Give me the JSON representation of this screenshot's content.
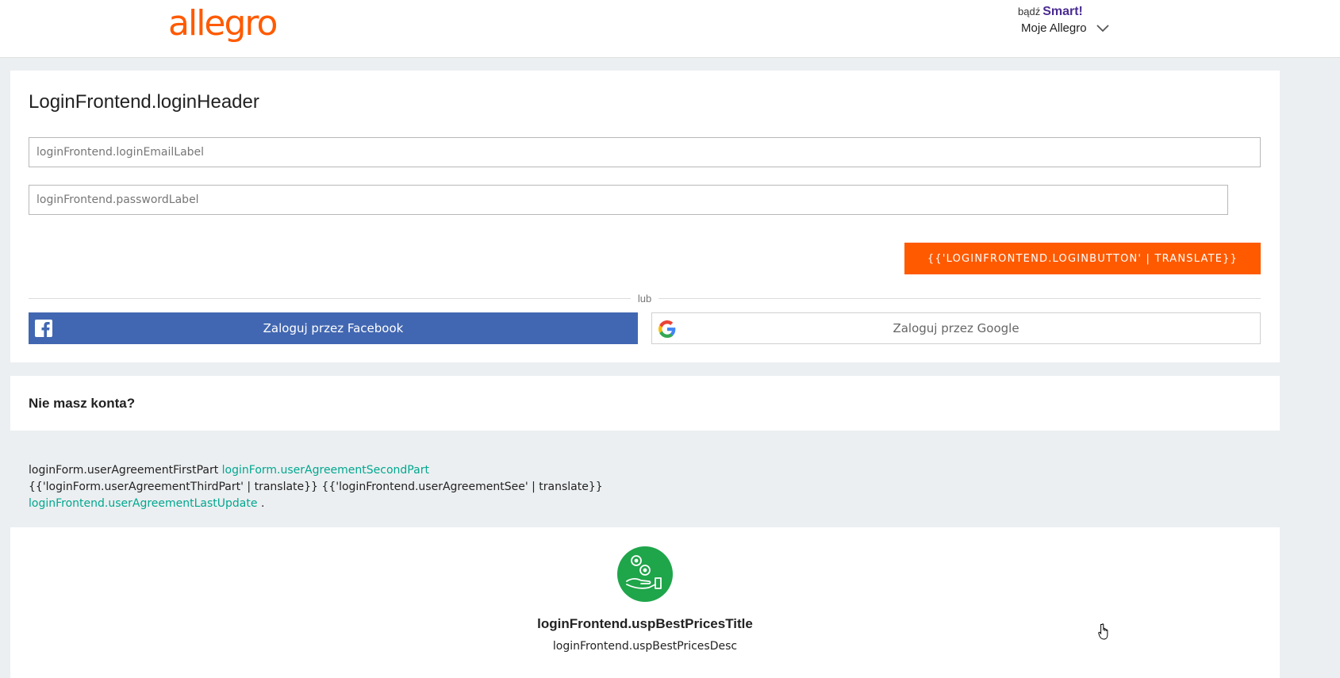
{
  "header": {
    "logo": "allegro",
    "smart_prefix": "bądź",
    "smart_brand": "Smart!",
    "account_label": "Moje Allegro",
    "icons": {
      "account_menu": "chevron-down-icon"
    }
  },
  "login": {
    "title": "LoginFrontend.loginHeader",
    "email_placeholder": "loginFrontend.loginEmailLabel",
    "password_placeholder": "loginFrontend.passwordLabel",
    "login_button": "{{'LOGINFRONTEND.LOGINBUTTON' | TRANSLATE}}",
    "divider_text": "lub",
    "facebook_button": "Zaloguj przez Facebook",
    "google_button": "Zaloguj przez Google"
  },
  "register": {
    "title": "Nie masz konta?"
  },
  "agreement": {
    "first": "loginForm.userAgreementFirstPart",
    "second_link": "loginForm.userAgreementSecondPart",
    "third": "{{'loginForm.userAgreementThirdPart' | translate}}",
    "see": "{{'loginFrontend.userAgreementSee' | translate}}",
    "last_link": "loginFrontend.userAgreementLastUpdate",
    "end": "."
  },
  "usp": {
    "icon": "hand-coins-icon",
    "title": "loginFrontend.uspBestPricesTitle",
    "desc": "loginFrontend.uspBestPricesDesc"
  },
  "colors": {
    "brand": "#ff5a00",
    "facebook": "#4267b2",
    "link": "#00a790",
    "smart": "#4a2c91",
    "usp_icon_bg": "#1fa54a"
  }
}
